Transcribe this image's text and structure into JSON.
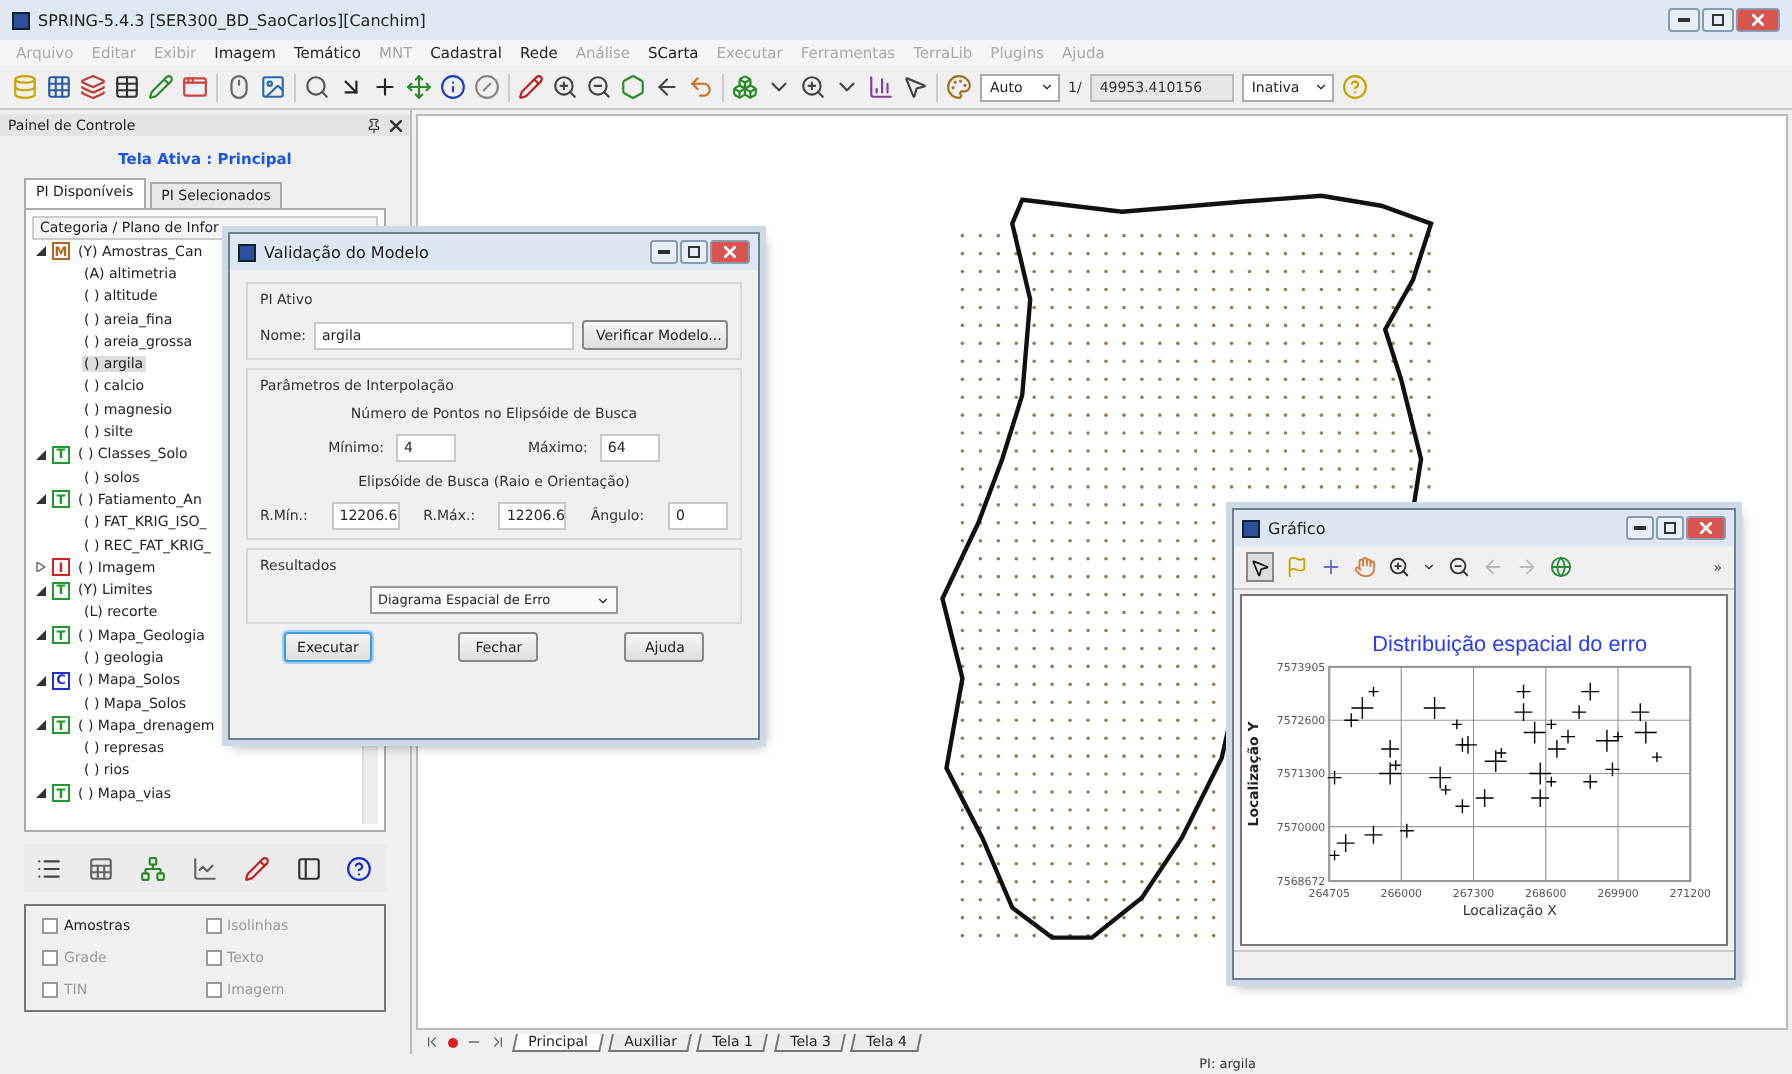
{
  "window": {
    "title": "SPRING-5.4.3 [SER300_BD_SaoCarlos][Canchim]"
  },
  "menu": [
    {
      "label": "Arquivo",
      "disabled": true
    },
    {
      "label": "Editar",
      "disabled": true
    },
    {
      "label": "Exibir",
      "disabled": true
    },
    {
      "label": "Imagem",
      "disabled": false
    },
    {
      "label": "Temático",
      "disabled": false
    },
    {
      "label": "MNT",
      "disabled": true
    },
    {
      "label": "Cadastral",
      "disabled": false
    },
    {
      "label": "Rede",
      "disabled": false
    },
    {
      "label": "Análise",
      "disabled": true
    },
    {
      "label": "SCarta",
      "disabled": false
    },
    {
      "label": "Executar",
      "disabled": true
    },
    {
      "label": "Ferramentas",
      "disabled": true
    },
    {
      "label": "TerraLib",
      "disabled": true
    },
    {
      "label": "Plugins",
      "disabled": true
    },
    {
      "label": "Ajuda",
      "disabled": true
    }
  ],
  "toolbar": {
    "scale_mode": "Auto",
    "scale_prefix": "1/",
    "scale_value": "49953.410156",
    "cursor_mode": "Inativa"
  },
  "control_panel": {
    "title": "Painel de Controle",
    "active_screen": "Tela Ativa : Principal",
    "tabs": [
      {
        "label": "PI Disponíveis",
        "selected": true
      },
      {
        "label": "PI Selecionados",
        "selected": false
      }
    ],
    "tree_header": "Categoria / Plano de Infor",
    "tree": [
      {
        "badge": "M",
        "color": "#b5651d",
        "label": "(Y) Amostras_Can",
        "expanded": true,
        "children": [
          {
            "label": "(A) altimetria",
            "selected": false
          },
          {
            "label": "( ) altitude",
            "selected": false
          },
          {
            "label": "( ) areia_fina",
            "selected": false
          },
          {
            "label": "( ) areia_grossa",
            "selected": false
          },
          {
            "label": "( ) argila",
            "selected": true
          },
          {
            "label": "( ) calcio",
            "selected": false
          },
          {
            "label": "( ) magnesio",
            "selected": false
          },
          {
            "label": "( ) silte",
            "selected": false
          }
        ]
      },
      {
        "badge": "T",
        "color": "#1f9a2e",
        "label": "( ) Classes_Solo",
        "expanded": true,
        "children": [
          {
            "label": "( ) solos",
            "selected": false
          }
        ]
      },
      {
        "badge": "T",
        "color": "#1f9a2e",
        "label": "( ) Fatiamento_An",
        "expanded": true,
        "children": [
          {
            "label": "( ) FAT_KRIG_ISO_",
            "selected": false
          },
          {
            "label": "( ) REC_FAT_KRIG_",
            "selected": false
          }
        ]
      },
      {
        "badge": "I",
        "color": "#d42020",
        "label": "( ) Imagem",
        "expanded": false
      },
      {
        "badge": "T",
        "color": "#1f9a2e",
        "label": "(Y) Limites",
        "expanded": true,
        "children": [
          {
            "label": "(L) recorte",
            "selected": false
          }
        ]
      },
      {
        "badge": "T",
        "color": "#1f9a2e",
        "label": "( ) Mapa_Geologia",
        "expanded": true,
        "children": [
          {
            "label": "( ) geologia",
            "selected": false
          }
        ]
      },
      {
        "badge": "C",
        "color": "#2030d0",
        "label": "( ) Mapa_Solos",
        "expanded": true,
        "children": [
          {
            "label": "( ) Mapa_Solos",
            "selected": false
          }
        ]
      },
      {
        "badge": "T",
        "color": "#1f9a2e",
        "label": "( ) Mapa_drenagem",
        "expanded": true,
        "children": [
          {
            "label": "( ) represas",
            "selected": false
          },
          {
            "label": "( ) rios",
            "selected": false
          }
        ]
      },
      {
        "badge": "T",
        "color": "#1f9a2e",
        "label": "( ) Mapa_vias",
        "expanded": true
      }
    ],
    "layers": [
      {
        "label": "Amostras",
        "checked": false,
        "disabled": false
      },
      {
        "label": "Isolinhas",
        "checked": false,
        "disabled": true
      },
      {
        "label": "Grade",
        "checked": false,
        "disabled": true
      },
      {
        "label": "Texto",
        "checked": false,
        "disabled": true
      },
      {
        "label": "TIN",
        "checked": false,
        "disabled": true
      },
      {
        "label": "Imagem",
        "checked": false,
        "disabled": true
      }
    ]
  },
  "dialog": {
    "title": "Validação do Modelo",
    "active_group": {
      "title": "PI Ativo",
      "name_label": "Nome:",
      "name_value": "argila",
      "verify_button": "Verificar Modelo..."
    },
    "interpolation": {
      "title": "Parâmetros de Interpolação",
      "points_heading": "Número de Pontos no Elipsóide de Busca",
      "min_label": "Mínimo:",
      "min_value": "4",
      "max_label": "Máximo:",
      "max_value": "64",
      "ellipse_heading": "Elipsóide de Busca (Raio e Orientação)",
      "rmin_label": "R.Mín.:",
      "rmin_value": "12206.6",
      "rmax_label": "R.Máx.:",
      "rmax_value": "12206.6",
      "angle_label": "Ângulo:",
      "angle_value": "0"
    },
    "results": {
      "title": "Resultados",
      "selection": "Diagrama Espacial de Erro"
    },
    "buttons": [
      {
        "label": "Executar",
        "focused": true
      },
      {
        "label": "Fechar",
        "focused": false
      },
      {
        "label": "Ajuda",
        "focused": false
      }
    ]
  },
  "graph_window": {
    "title": "Gráfico",
    "overflow": "»",
    "chart_data": {
      "type": "scatter",
      "title": "Distribuição espacial do erro",
      "xlabel": "Localização X",
      "ylabel": "Localização Y",
      "grid": true,
      "xlim": [
        264705,
        271200
      ],
      "ylim": [
        7568672,
        7573905
      ],
      "xticks": [
        264705,
        266000,
        267300,
        268600,
        269900,
        271200
      ],
      "yticks": [
        7568672,
        7570000,
        7571300,
        7572600,
        7573905
      ],
      "x": [
        264800,
        264800,
        265000,
        265300,
        265500,
        265100,
        265500,
        265800,
        265900,
        266100,
        265800,
        266600,
        267000,
        267100,
        267200,
        266700,
        266800,
        267100,
        267500,
        267700,
        267800,
        268200,
        268200,
        268400,
        268700,
        269000,
        268800,
        268500,
        268700,
        269200,
        269400,
        269700,
        269900,
        269800,
        270300,
        270400,
        270600,
        269400,
        268500
      ],
      "series": [
        {
          "color": "#000000",
          "values": [
            7569300,
            7571200,
            7569600,
            7572900,
            7573300,
            7572600,
            7569800,
            7571300,
            7571500,
            7569900,
            7571900,
            7572900,
            7572500,
            7572000,
            7572000,
            7571200,
            7570900,
            7570500,
            7570700,
            7571600,
            7571800,
            7573300,
            7572800,
            7572300,
            7572500,
            7572200,
            7571900,
            7571300,
            7571100,
            7572800,
            7573300,
            7572100,
            7572200,
            7571400,
            7572800,
            7572300,
            7571700,
            7571100,
            7570700
          ]
        }
      ]
    }
  },
  "map": {
    "tabs": [
      {
        "label": "Principal",
        "selected": true
      },
      {
        "label": "Auxiliar",
        "selected": false
      },
      {
        "label": "Tela 1",
        "selected": false
      },
      {
        "label": "Tela 3",
        "selected": false
      },
      {
        "label": "Tela 4",
        "selected": false
      }
    ]
  },
  "status_bar": {
    "text": "PI: argila"
  }
}
